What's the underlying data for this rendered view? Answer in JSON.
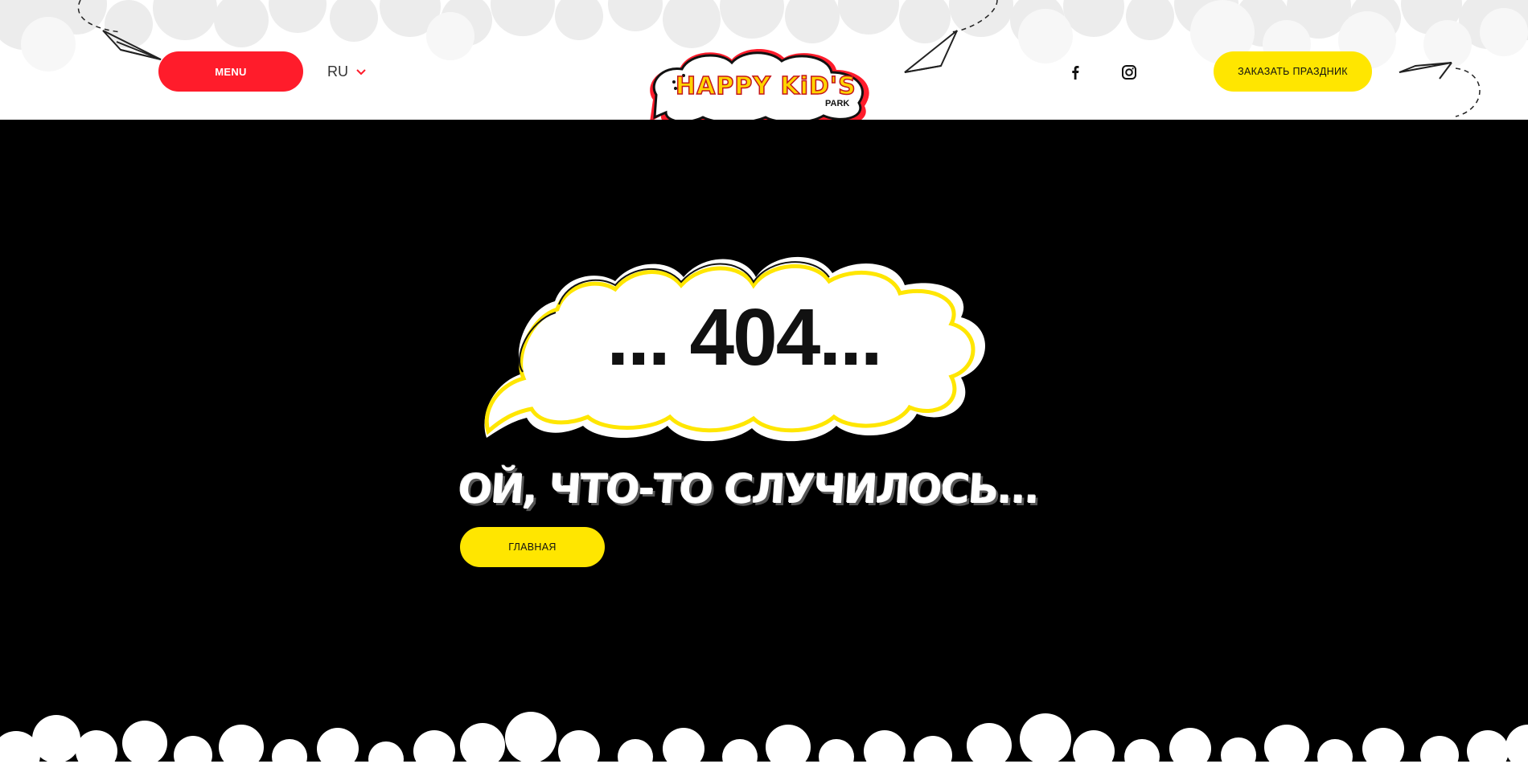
{
  "header": {
    "menu_label": "MENU",
    "language": "RU",
    "order_label": "ЗАКАЗАТЬ ПРАЗДНИК",
    "logo_text_main": "HAPPY KiD'S",
    "logo_text_sub": "PARK",
    "social": [
      "facebook-icon",
      "instagram-icon"
    ]
  },
  "error": {
    "code": "... 404...",
    "title": "ОЙ, ЧТО-ТО СЛУЧИЛОСЬ...",
    "home_label": "ГЛАВНАЯ"
  },
  "colors": {
    "accent_red": "#ff1c2b",
    "accent_yellow": "#ffe600",
    "background": "#000000",
    "header_bg": "#ffffff"
  }
}
